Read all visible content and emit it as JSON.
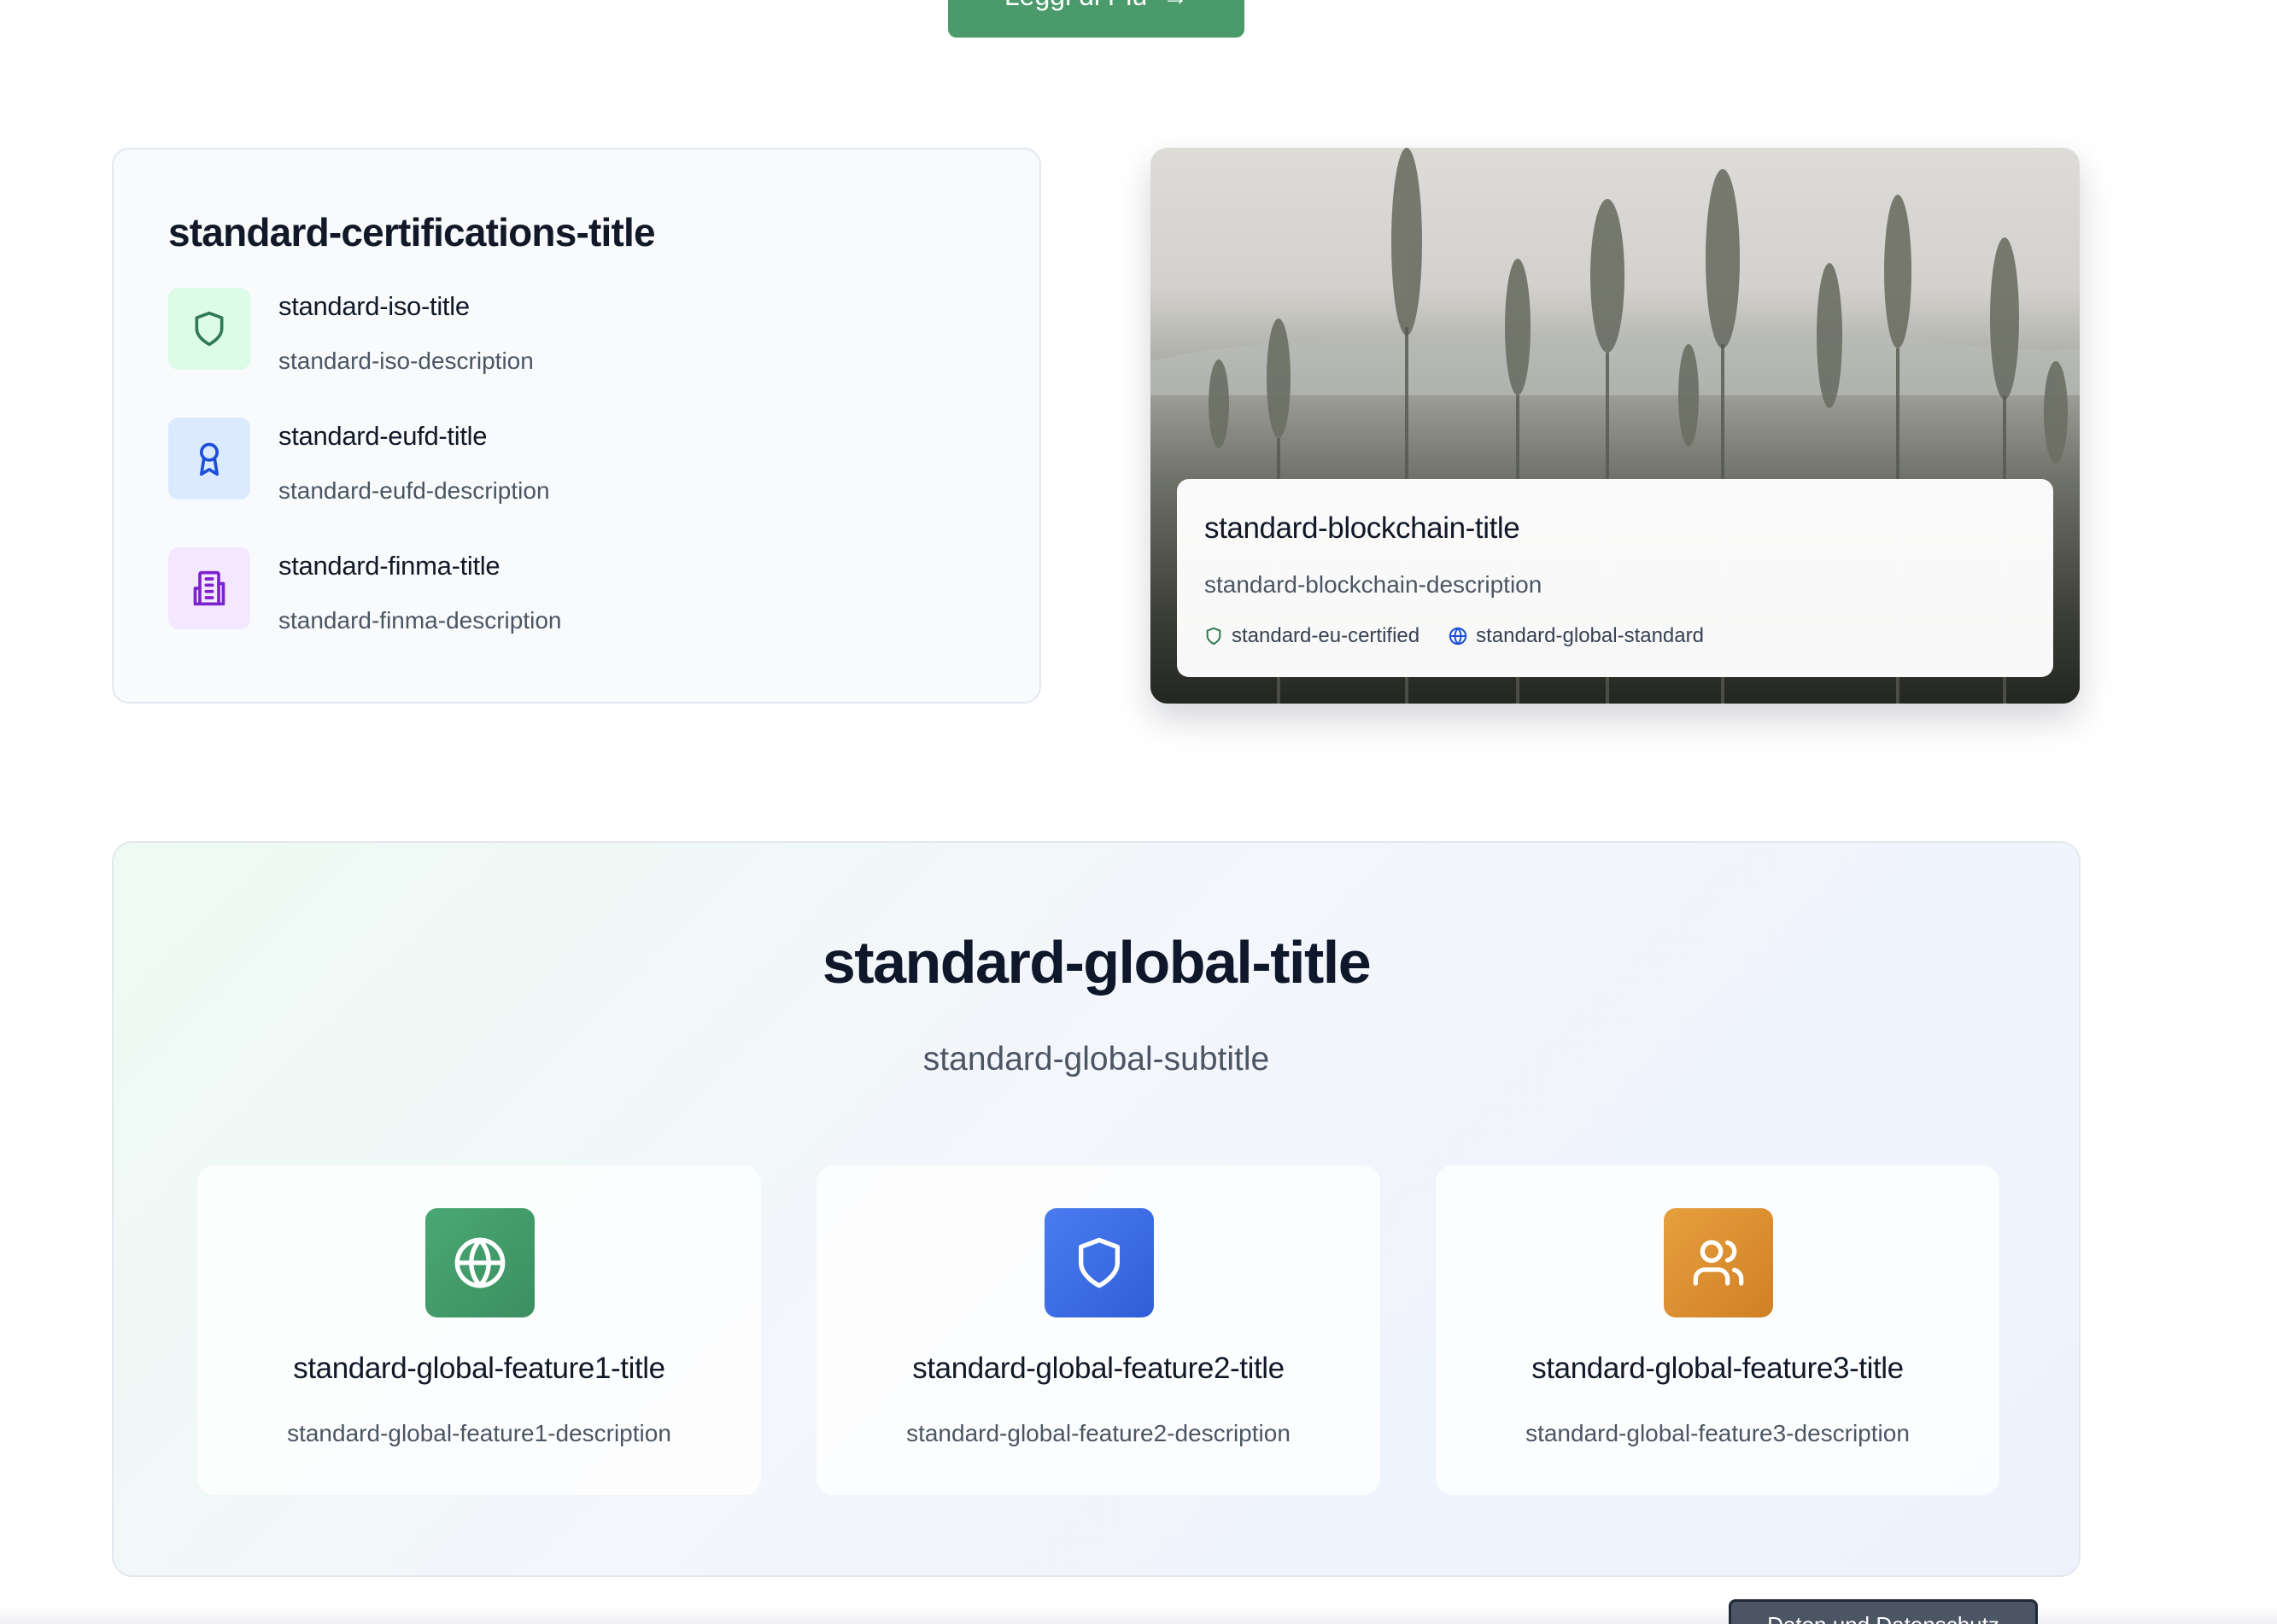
{
  "cta": {
    "label": "Leggi di Più",
    "arrow": "→"
  },
  "certifications": {
    "title": "standard-certifications-title",
    "items": [
      {
        "title": "standard-iso-title",
        "description": "standard-iso-description",
        "icon": "shield-icon",
        "icon_bg": "#dcfce7",
        "icon_color": "#2f7a52"
      },
      {
        "title": "standard-eufd-title",
        "description": "standard-eufd-description",
        "icon": "award-icon",
        "icon_bg": "#dbeafe",
        "icon_color": "#1d4ed8"
      },
      {
        "title": "standard-finma-title",
        "description": "standard-finma-description",
        "icon": "building-icon",
        "icon_bg": "#f3e8ff",
        "icon_color": "#7e22ce"
      }
    ]
  },
  "blockchain": {
    "title": "standard-blockchain-title",
    "description": "standard-blockchain-description",
    "tags": [
      {
        "label": "standard-eu-certified",
        "icon": "shield-icon",
        "color": "#2f7a52"
      },
      {
        "label": "standard-global-standard",
        "icon": "globe-icon",
        "color": "#1d4ed8"
      }
    ]
  },
  "global": {
    "title": "standard-global-title",
    "subtitle": "standard-global-subtitle",
    "features": [
      {
        "title": "standard-global-feature1-title",
        "description": "standard-global-feature1-description",
        "icon": "globe-icon",
        "color_from": "#4aa874",
        "color_to": "#3b8f60"
      },
      {
        "title": "standard-global-feature2-title",
        "description": "standard-global-feature2-description",
        "icon": "shield-icon",
        "color_from": "#4a7cf0",
        "color_to": "#2f5fd8"
      },
      {
        "title": "standard-global-feature3-title",
        "description": "standard-global-feature3-description",
        "icon": "users-icon",
        "color_from": "#e6a03d",
        "color_to": "#d17f25"
      }
    ]
  },
  "privacy": {
    "label": "Daten und Datenschutz"
  }
}
